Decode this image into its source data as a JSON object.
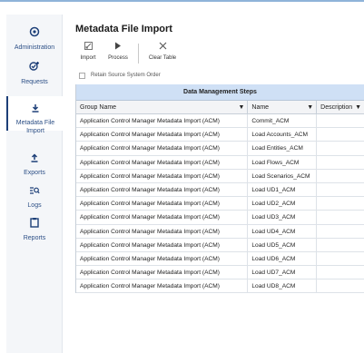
{
  "nav": {
    "items": [
      {
        "label": "Administration",
        "icon": "admin-gear-icon"
      },
      {
        "label": "Requests",
        "icon": "requests-icon"
      },
      {
        "label": "Metadata File Import",
        "icon": "download-icon",
        "active": true
      },
      {
        "label": "Exports",
        "icon": "upload-icon"
      },
      {
        "label": "Logs",
        "icon": "logs-search-icon"
      },
      {
        "label": "Reports",
        "icon": "clipboard-icon"
      }
    ]
  },
  "page": {
    "title": "Metadata File Import"
  },
  "toolbar": {
    "import_label": "Import",
    "process_label": "Process",
    "clear_label": "Clear Table"
  },
  "retain": {
    "label": "Retain Source System Order",
    "checked": false
  },
  "grid": {
    "title": "Data Management Steps",
    "columns": [
      "Group Name",
      "Name",
      "Description"
    ],
    "rows": [
      [
        "Application Control Manager Metadata Import (ACM)",
        "Commit_ACM",
        ""
      ],
      [
        "Application Control Manager Metadata Import (ACM)",
        "Load Accounts_ACM",
        ""
      ],
      [
        "Application Control Manager Metadata Import (ACM)",
        "Load Entities_ACM",
        ""
      ],
      [
        "Application Control Manager Metadata Import (ACM)",
        "Load Flows_ACM",
        ""
      ],
      [
        "Application Control Manager Metadata Import (ACM)",
        "Load Scenarios_ACM",
        ""
      ],
      [
        "Application Control Manager Metadata Import (ACM)",
        "Load UD1_ACM",
        ""
      ],
      [
        "Application Control Manager Metadata Import (ACM)",
        "Load UD2_ACM",
        ""
      ],
      [
        "Application Control Manager Metadata Import (ACM)",
        "Load UD3_ACM",
        ""
      ],
      [
        "Application Control Manager Metadata Import (ACM)",
        "Load UD4_ACM",
        ""
      ],
      [
        "Application Control Manager Metadata Import (ACM)",
        "Load UD5_ACM",
        ""
      ],
      [
        "Application Control Manager Metadata Import (ACM)",
        "Load UD6_ACM",
        ""
      ],
      [
        "Application Control Manager Metadata Import (ACM)",
        "Load UD7_ACM",
        ""
      ],
      [
        "Application Control Manager Metadata Import (ACM)",
        "Load UD8_ACM",
        ""
      ]
    ]
  },
  "colors": {
    "accent": "#1d3f78",
    "header_bg": "#cfe0f5"
  }
}
